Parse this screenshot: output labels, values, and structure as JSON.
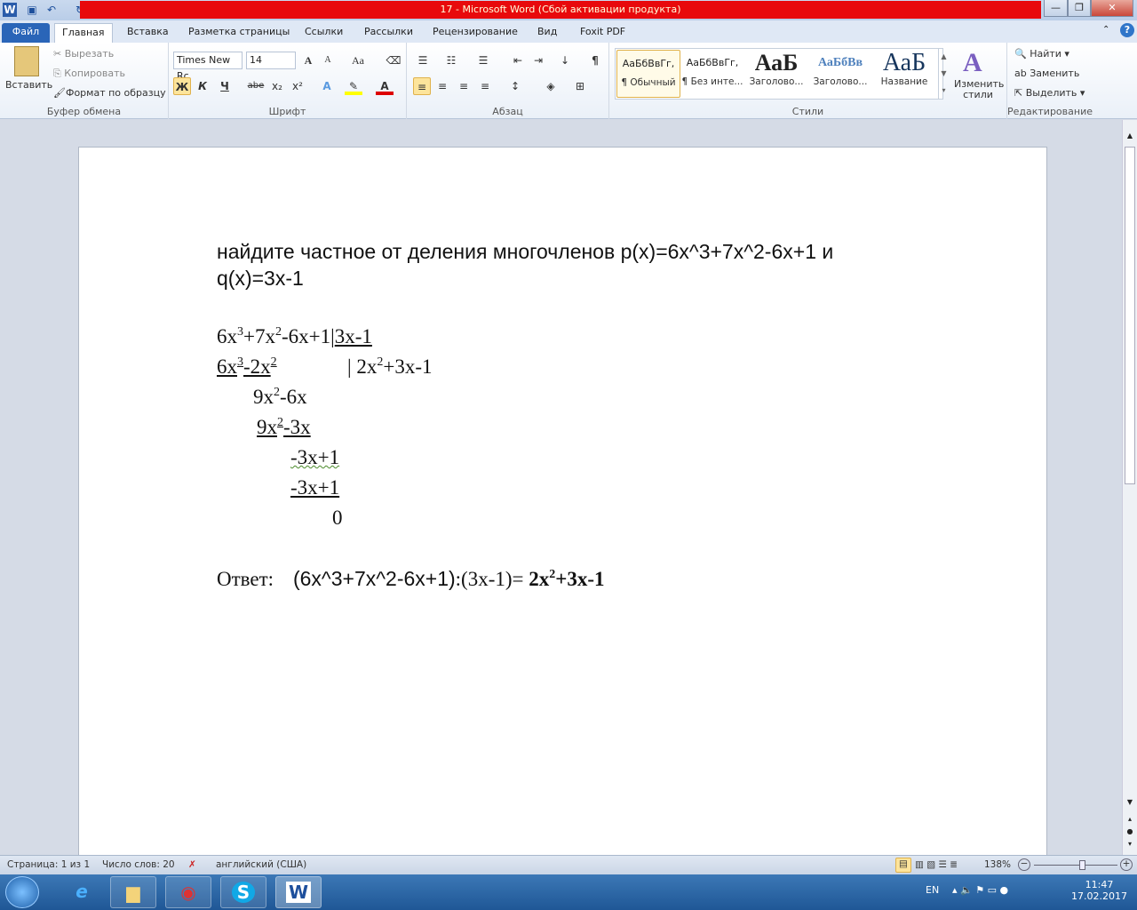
{
  "window": {
    "title": "17  -  Microsoft Word (Сбой активации продукта)",
    "controls": [
      "—",
      "❐",
      "✕"
    ]
  },
  "quick_access": [
    "W",
    "💾",
    "↶",
    "↻"
  ],
  "tabs": [
    "Файл",
    "Главная",
    "Вставка",
    "Разметка страницы",
    "Ссылки",
    "Рассылки",
    "Рецензирование",
    "Вид",
    "Foxit PDF"
  ],
  "clipboard": {
    "paste": "Вставить",
    "cut": "Вырезать",
    "copy": "Копировать",
    "format_painter": "Формат по образцу",
    "label": "Буфер обмена"
  },
  "font": {
    "name": "Times New Rc",
    "size": "14",
    "bold": "Ж",
    "italic": "К",
    "underline": "Ч",
    "strike": "abe",
    "sub": "x₂",
    "sup": "x²",
    "label": "Шрифт"
  },
  "paragraph": {
    "label": "Абзац",
    "pilcrow": "¶"
  },
  "styles": {
    "items": [
      {
        "preview": "АаБбВвГг,",
        "name": "¶ Обычный"
      },
      {
        "preview": "АаБбВвГг,",
        "name": "¶ Без инте..."
      },
      {
        "preview": "АаБ",
        "name": "Заголово..."
      },
      {
        "preview": "АаБбВв",
        "name": "Заголово..."
      },
      {
        "preview": "АаБ",
        "name": "Название"
      }
    ],
    "change": "Изменить стили",
    "label": "Стили"
  },
  "editing": {
    "find": "Найти",
    "replace": "Заменить",
    "select": "Выделить",
    "label": "Редактирование"
  },
  "document": {
    "task_line1": "найдите частное от деления многочленов p(x)=6x^3+7x^2-6x+1 и",
    "task_line2": "q(x)=3x-1",
    "division": [
      [
        {
          "t": "6x"
        },
        {
          "t": "3",
          "sup": true
        },
        {
          "t": "+7x"
        },
        {
          "t": "2",
          "sup": true
        },
        {
          "t": "-6x+1|"
        },
        {
          "t": "3x-1",
          "u": true
        }
      ],
      [
        {
          "t": "6x",
          "u": true
        },
        {
          "t": "3",
          "sup": true,
          "u": true
        },
        {
          "t": "-2x",
          "u": true
        },
        {
          "t": "2",
          "sup": true,
          "u": true
        }
      ],
      [
        {
          "t": "9x"
        },
        {
          "t": "2",
          "sup": true
        },
        {
          "t": "-6x"
        }
      ],
      [
        {
          "t": "9x",
          "u": true
        },
        {
          "t": "2",
          "sup": true,
          "u": true
        },
        {
          "t": "-3x",
          "u": true
        }
      ],
      [
        {
          "t": "-3x+1",
          "w": true
        }
      ],
      [
        {
          "t": "-3x+1",
          "u": true
        }
      ],
      [
        {
          "t": "0"
        }
      ]
    ],
    "quotient": [
      {
        "t": "| 2x"
      },
      {
        "t": "2",
        "sup": true
      },
      {
        "t": "+3x-1"
      }
    ],
    "answer_label": "Ответ:",
    "answer_expr": "(6x^3+7x^2-6x+1)",
    "answer_div": ":(3x-1)= ",
    "answer_result": [
      {
        "t": "2x",
        "b": true
      },
      {
        "t": "2",
        "sup": true,
        "b": true
      },
      {
        "t": "+3x-1",
        "b": true
      }
    ]
  },
  "status": {
    "page": "Страница: 1 из 1",
    "words": "Число слов: 20",
    "language": "английский (США)",
    "zoom": "138%",
    "zoom_percent": 138
  },
  "taskbar": {
    "lang": "EN",
    "time": "11:47",
    "date": "17.02.2017"
  }
}
